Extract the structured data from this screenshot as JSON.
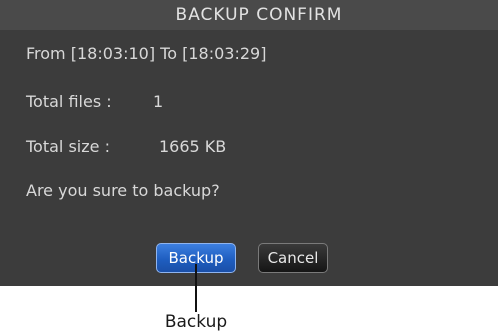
{
  "dialog": {
    "title": "BACKUP CONFIRM",
    "range_text": "From [18:03:10] To [18:03:29]",
    "total_files_label": "Total files :",
    "total_files_value": "1",
    "total_size_label": "Total size :",
    "total_size_value": "1665 KB",
    "question": "Are you sure to backup?",
    "backup_button_label": "Backup",
    "cancel_button_label": "Cancel"
  },
  "callout": {
    "label": "Backup"
  },
  "colors": {
    "dialog_background": "#3c3c3c",
    "title_bar": "#4a4a4a",
    "text": "#d8d8d8",
    "backup_button": "#1f5ec0",
    "cancel_button": "#151515"
  }
}
